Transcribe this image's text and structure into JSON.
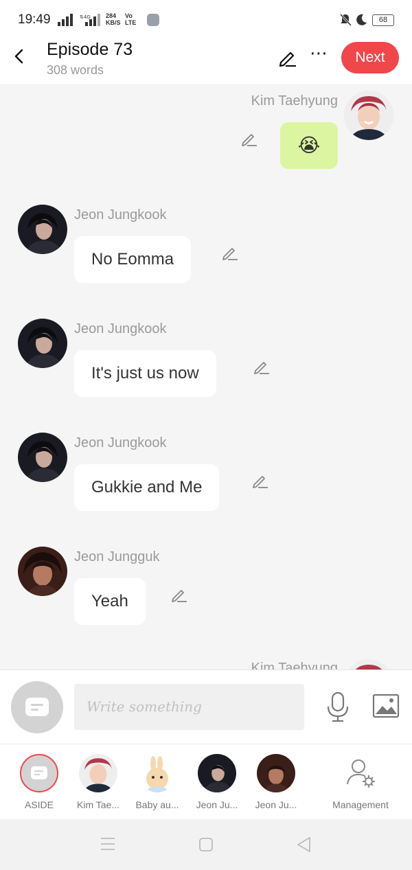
{
  "status": {
    "time": "19:49",
    "net_speed_value": "284",
    "net_speed_unit": "KB/S",
    "volte_top": "Vo",
    "volte_bottom": "LTE",
    "battery": "68"
  },
  "header": {
    "title": "Episode 73",
    "word_count": "308 words",
    "next_label": "Next"
  },
  "messages": [
    {
      "speaker": "Kim Taehyung",
      "text": "😭",
      "side": "right"
    },
    {
      "speaker": "Jeon Jungkook",
      "text": "No Eomma",
      "side": "left"
    },
    {
      "speaker": "Jeon Jungkook",
      "text": "It's just us now",
      "side": "left"
    },
    {
      "speaker": "Jeon Jungkook",
      "text": "Gukkie and Me",
      "side": "left"
    },
    {
      "speaker": "Jeon Jungguk",
      "text": "Yeah",
      "side": "left"
    },
    {
      "speaker": "Kim Taehyung",
      "text": "",
      "side": "right"
    }
  ],
  "input": {
    "placeholder": "Write something"
  },
  "characters": [
    {
      "label": "ASIDE"
    },
    {
      "label": "Kim Tae..."
    },
    {
      "label": "Baby au..."
    },
    {
      "label": "Jeon Ju..."
    },
    {
      "label": "Jeon Ju..."
    },
    {
      "label": "Management"
    }
  ],
  "colors": {
    "accent": "#f0474b",
    "emoji_bubble": "#dcf5a0",
    "background": "#f5f5f5"
  }
}
